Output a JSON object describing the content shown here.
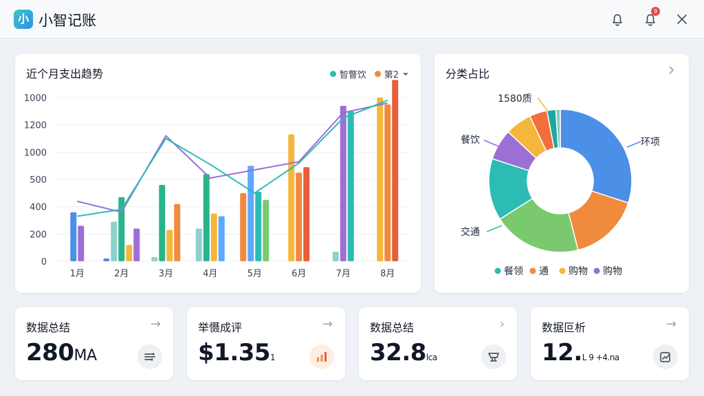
{
  "app": {
    "icon_text": "小",
    "title": "小智记账"
  },
  "topbar": {
    "notification_badge": "9"
  },
  "trend": {
    "title": "近个月支出趋势",
    "legend": [
      {
        "label": "智瞥饮",
        "color": "#2cbcb4"
      },
      {
        "label": "第2",
        "color": "#f08a3c"
      }
    ]
  },
  "chart_data": [
    {
      "type": "bar",
      "categories": [
        "1月",
        "2月",
        "3月",
        "4月",
        "5月",
        "6月",
        "7月",
        "8月"
      ],
      "y_tick_labels": [
        "0",
        "200",
        "400",
        "500",
        "1000",
        "1200",
        "1000"
      ],
      "series": [
        {
          "color": "#4c8fe6",
          "values": [
            360,
            20,
            0,
            0,
            0,
            0,
            0,
            0
          ]
        },
        {
          "color": "#8fd0cf",
          "values": [
            0,
            290,
            30,
            240,
            0,
            0,
            70,
            0
          ]
        },
        {
          "color": "#29b58c",
          "values": [
            0,
            470,
            560,
            640,
            0,
            0,
            0,
            0
          ]
        },
        {
          "color": "#f4b63c",
          "values": [
            0,
            120,
            230,
            350,
            0,
            930,
            0,
            1200
          ]
        },
        {
          "color": "#f08a3c",
          "values": [
            0,
            0,
            420,
            0,
            500,
            650,
            0,
            1150
          ]
        },
        {
          "color": "#9b6fd6",
          "values": [
            260,
            240,
            0,
            0,
            0,
            0,
            1140,
            0
          ]
        },
        {
          "color": "#5ca9ff",
          "values": [
            0,
            0,
            0,
            330,
            700,
            0,
            0,
            0
          ]
        },
        {
          "color": "#2cbcb4",
          "values": [
            0,
            0,
            0,
            0,
            510,
            0,
            1100,
            0
          ]
        },
        {
          "color": "#7bc96f",
          "values": [
            0,
            0,
            0,
            0,
            450,
            0,
            0,
            0
          ]
        },
        {
          "color": "#e85d3c",
          "values": [
            0,
            0,
            0,
            0,
            0,
            690,
            0,
            1330
          ]
        }
      ],
      "lines": [
        {
          "color": "#9b6fd6",
          "values": [
            440,
            360,
            920,
            610,
            670,
            730,
            1090,
            1160
          ]
        },
        {
          "color": "#2cbcb4",
          "values": [
            330,
            380,
            900,
            710,
            500,
            720,
            1050,
            1180
          ]
        }
      ],
      "ylim": [
        0,
        1200
      ],
      "grid": true
    },
    {
      "type": "pie",
      "title": "分类占比",
      "donut": true,
      "callouts": [
        "1580质",
        "餐饮",
        "环项",
        "交通"
      ],
      "slices": [
        {
          "value": 30,
          "color": "#4c8fe6"
        },
        {
          "value": 16,
          "color": "#f08a3c"
        },
        {
          "value": 20,
          "color": "#7bc96f"
        },
        {
          "value": 14,
          "color": "#2cbcb4"
        },
        {
          "value": 7,
          "color": "#9b6fd6"
        },
        {
          "value": 6,
          "color": "#f4b63c"
        },
        {
          "value": 4,
          "color": "#f26f3c"
        },
        {
          "value": 2,
          "color": "#1ea7a0"
        },
        {
          "value": 1,
          "color": "#7fd1b9"
        }
      ],
      "legend": [
        {
          "label": "餐领",
          "color": "#2cbcb4"
        },
        {
          "label": "通",
          "color": "#f08a3c"
        },
        {
          "label": "购物",
          "color": "#f4b63c"
        },
        {
          "label": "购物",
          "color": "#9b6fd6"
        }
      ]
    }
  ],
  "stats": [
    {
      "title": "数据总结",
      "value": "280",
      "unit": "MA",
      "small": "",
      "icon": "filter-lines-icon",
      "icon_color": "#4b5563",
      "icon_bg": "#eef0f3"
    },
    {
      "title": "举慑成评",
      "value": "$1.35",
      "unit": "",
      "small": "1",
      "icon": "bar-chart-icon",
      "icon_color": "#f08a3c",
      "icon_bg": "#fdeee3"
    },
    {
      "title": "数据总结",
      "value": "32.8",
      "unit": "",
      "small": "lca",
      "icon": "cart-icon",
      "icon_color": "#4b5563",
      "icon_bg": "#eef0f3"
    },
    {
      "title": "数据叵析",
      "value": "12.",
      "unit": "",
      "small": "L 9 +4.na",
      "icon": "chart-edit-icon",
      "icon_color": "#4b5563",
      "icon_bg": "#eef0f3"
    }
  ]
}
